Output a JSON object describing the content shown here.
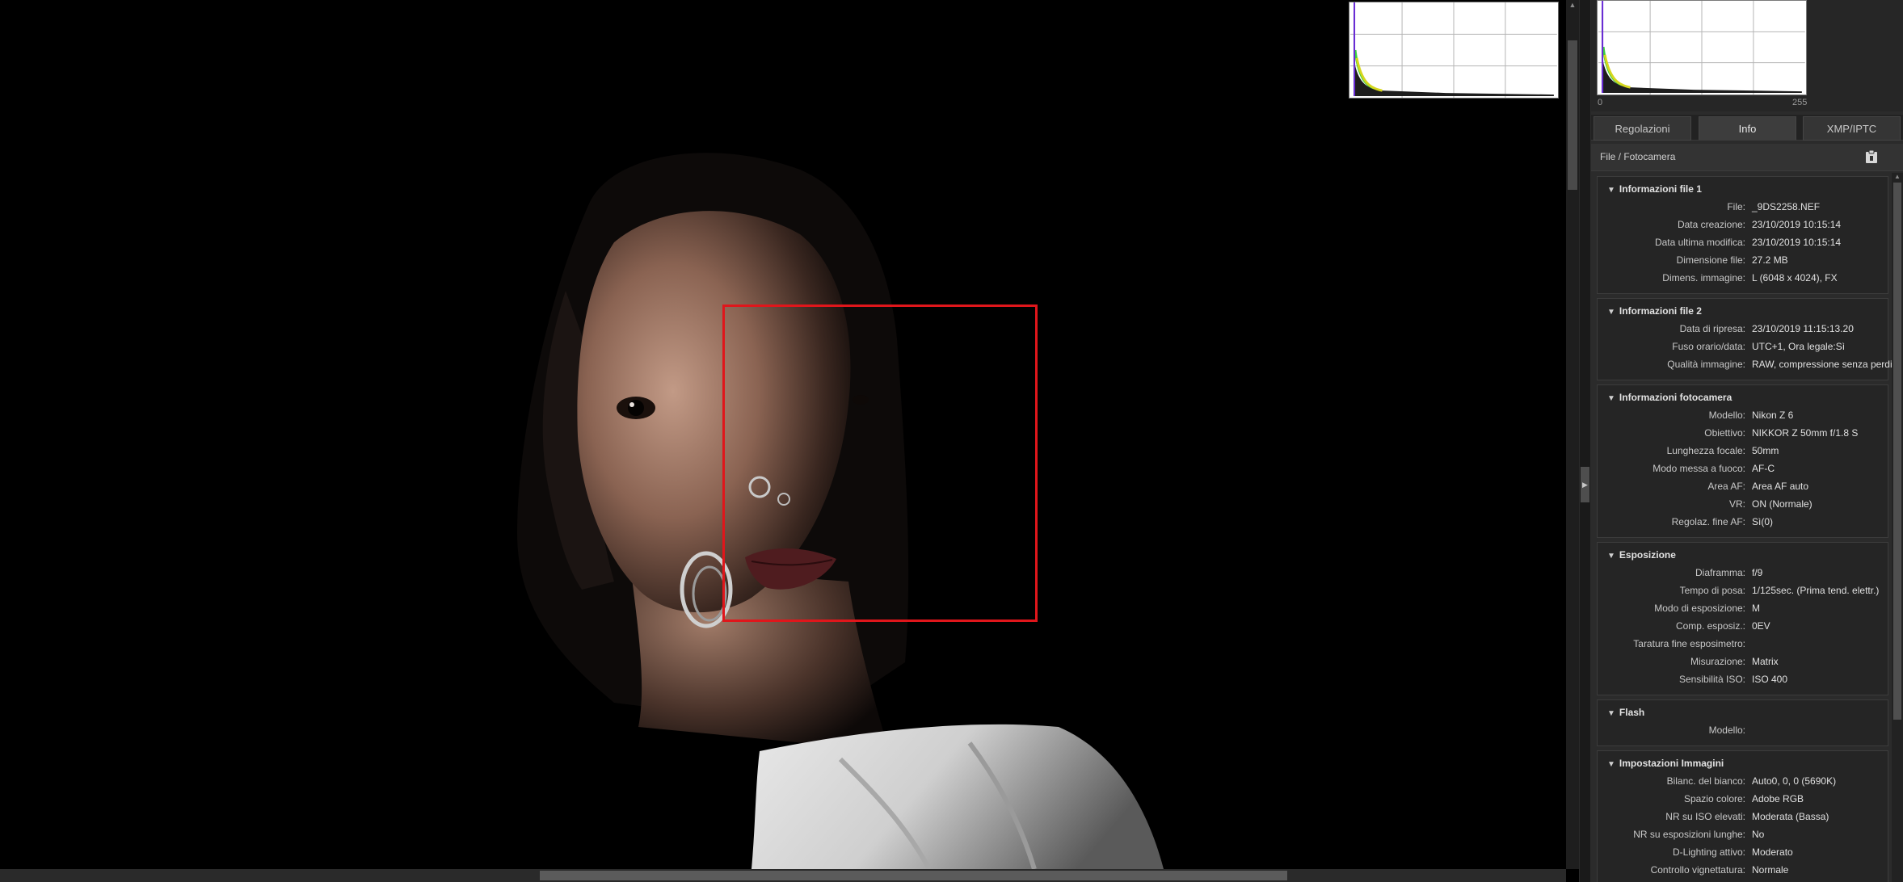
{
  "viewer": {
    "face_box_color": "#e0161b"
  },
  "histogram": {
    "axis_min": "0",
    "axis_max": "255"
  },
  "tabs": [
    {
      "label": "Regolazioni",
      "active": false
    },
    {
      "label": "Info",
      "active": true
    },
    {
      "label": "XMP/IPTC",
      "active": false
    }
  ],
  "section": {
    "title": "File / Fotocamera",
    "clipboard_icon": "clipboard-icon"
  },
  "groups": [
    {
      "title": "Informazioni file 1",
      "rows": [
        {
          "label": "File:",
          "value": "_9DS2258.NEF"
        },
        {
          "label": "Data creazione:",
          "value": "23/10/2019 10:15:14"
        },
        {
          "label": "Data ultima modifica:",
          "value": "23/10/2019 10:15:14"
        },
        {
          "label": "Dimensione file:",
          "value": "27.2 MB"
        },
        {
          "label": "Dimens. immagine:",
          "value": "L (6048 x 4024), FX"
        }
      ]
    },
    {
      "title": "Informazioni file 2",
      "rows": [
        {
          "label": "Data di ripresa:",
          "value": "23/10/2019 11:15:13.20"
        },
        {
          "label": "Fuso orario/data:",
          "value": "UTC+1, Ora legale:Sì"
        },
        {
          "label": "Qualità immagine:",
          "value": "RAW, compressione senza perdit"
        }
      ]
    },
    {
      "title": "Informazioni fotocamera",
      "rows": [
        {
          "label": "Modello:",
          "value": "Nikon Z 6"
        },
        {
          "label": "Obiettivo:",
          "value": "NIKKOR Z 50mm f/1.8 S"
        },
        {
          "label": "Lunghezza focale:",
          "value": "50mm"
        },
        {
          "label": "Modo messa a fuoco:",
          "value": "AF-C"
        },
        {
          "label": "Area AF:",
          "value": "Area AF auto"
        },
        {
          "label": "VR:",
          "value": "ON (Normale)"
        },
        {
          "label": "Regolaz. fine AF:",
          "value": "Sì(0)"
        }
      ]
    },
    {
      "title": "Esposizione",
      "rows": [
        {
          "label": "Diaframma:",
          "value": "f/9"
        },
        {
          "label": "Tempo di posa:",
          "value": "1/125sec. (Prima tend. elettr.)"
        },
        {
          "label": "Modo di esposizione:",
          "value": "M"
        },
        {
          "label": "Comp. esposiz.:",
          "value": "0EV"
        },
        {
          "label": "Taratura fine esposimetro:",
          "value": ""
        },
        {
          "label": "Misurazione:",
          "value": "Matrix"
        },
        {
          "label": "Sensibilità ISO:",
          "value": "ISO 400"
        }
      ]
    },
    {
      "title": "Flash",
      "rows": [
        {
          "label": "Modello:",
          "value": ""
        }
      ]
    },
    {
      "title": "Impostazioni Immagini",
      "rows": [
        {
          "label": "Bilanc. del bianco:",
          "value": "Auto0, 0, 0 (5690K)"
        },
        {
          "label": "Spazio colore:",
          "value": "Adobe RGB"
        },
        {
          "label": "NR su ISO elevati:",
          "value": "Moderata (Bassa)"
        },
        {
          "label": "NR su esposizioni lunghe:",
          "value": "No"
        },
        {
          "label": "D-Lighting attivo:",
          "value": "Moderato"
        },
        {
          "label": "Controllo vignettatura:",
          "value": "Normale"
        }
      ]
    }
  ]
}
